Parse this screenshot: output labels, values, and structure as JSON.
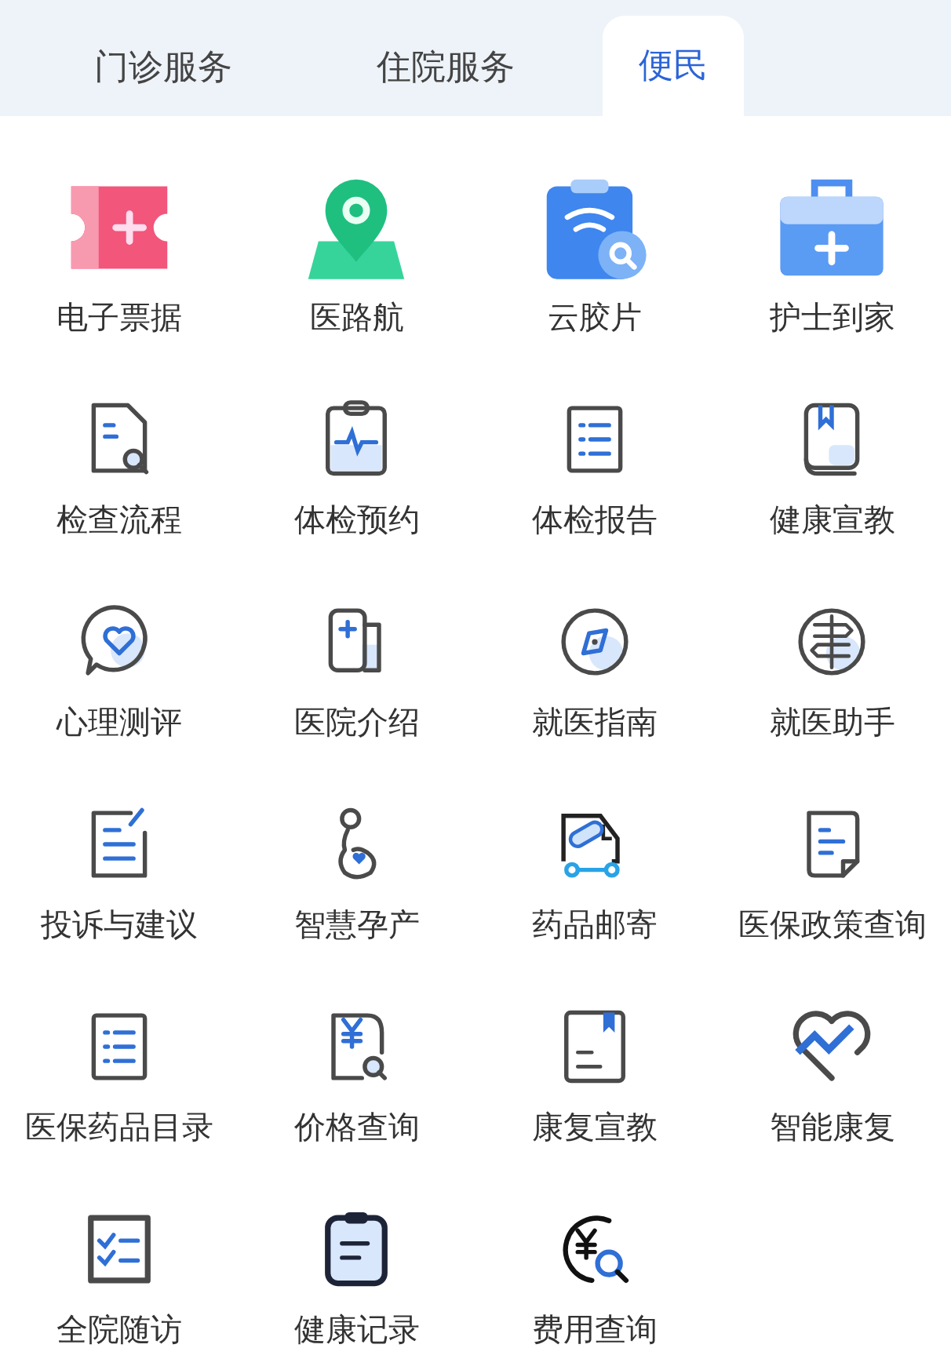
{
  "tabs": [
    {
      "label": "门诊服务",
      "selected": false
    },
    {
      "label": "住院服务",
      "selected": false
    },
    {
      "label": "便民",
      "selected": true
    }
  ],
  "services": [
    {
      "label": "电子票据"
    },
    {
      "label": "医路航"
    },
    {
      "label": "云胶片"
    },
    {
      "label": "护士到家"
    },
    {
      "label": "检查流程"
    },
    {
      "label": "体检预约"
    },
    {
      "label": "体检报告"
    },
    {
      "label": "健康宣教"
    },
    {
      "label": "心理测评"
    },
    {
      "label": "医院介绍"
    },
    {
      "label": "就医指南"
    },
    {
      "label": "就医助手"
    },
    {
      "label": "投诉与建议"
    },
    {
      "label": "智慧孕产"
    },
    {
      "label": "药品邮寄"
    },
    {
      "label": "医保政策查询"
    },
    {
      "label": "医保药品目录"
    },
    {
      "label": "价格查询"
    },
    {
      "label": "康复宣教"
    },
    {
      "label": "智能康复"
    },
    {
      "label": "全院随访"
    },
    {
      "label": "健康记录"
    },
    {
      "label": "费用查询"
    }
  ]
}
